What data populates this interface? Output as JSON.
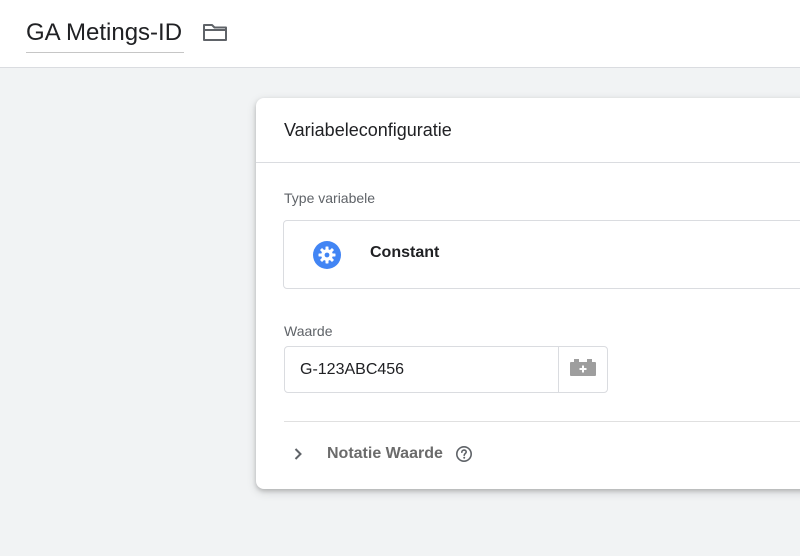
{
  "header": {
    "title": "GA Metings-ID"
  },
  "icons": {
    "folder": "folder-icon",
    "type": "gear-icon",
    "variable_picker": "variable-brick-icon",
    "expand": "chevron-right-icon",
    "help": "help-circle-icon"
  },
  "card": {
    "title": "Variabeleconfiguratie",
    "type_label": "Type variabele",
    "type_name": "Constant",
    "value_label": "Waarde",
    "value": "G-123ABC456",
    "format_label": "Notatie Waarde"
  },
  "colors": {
    "accent": "#4285f4",
    "background": "#f1f3f4",
    "border": "#dadce0"
  }
}
